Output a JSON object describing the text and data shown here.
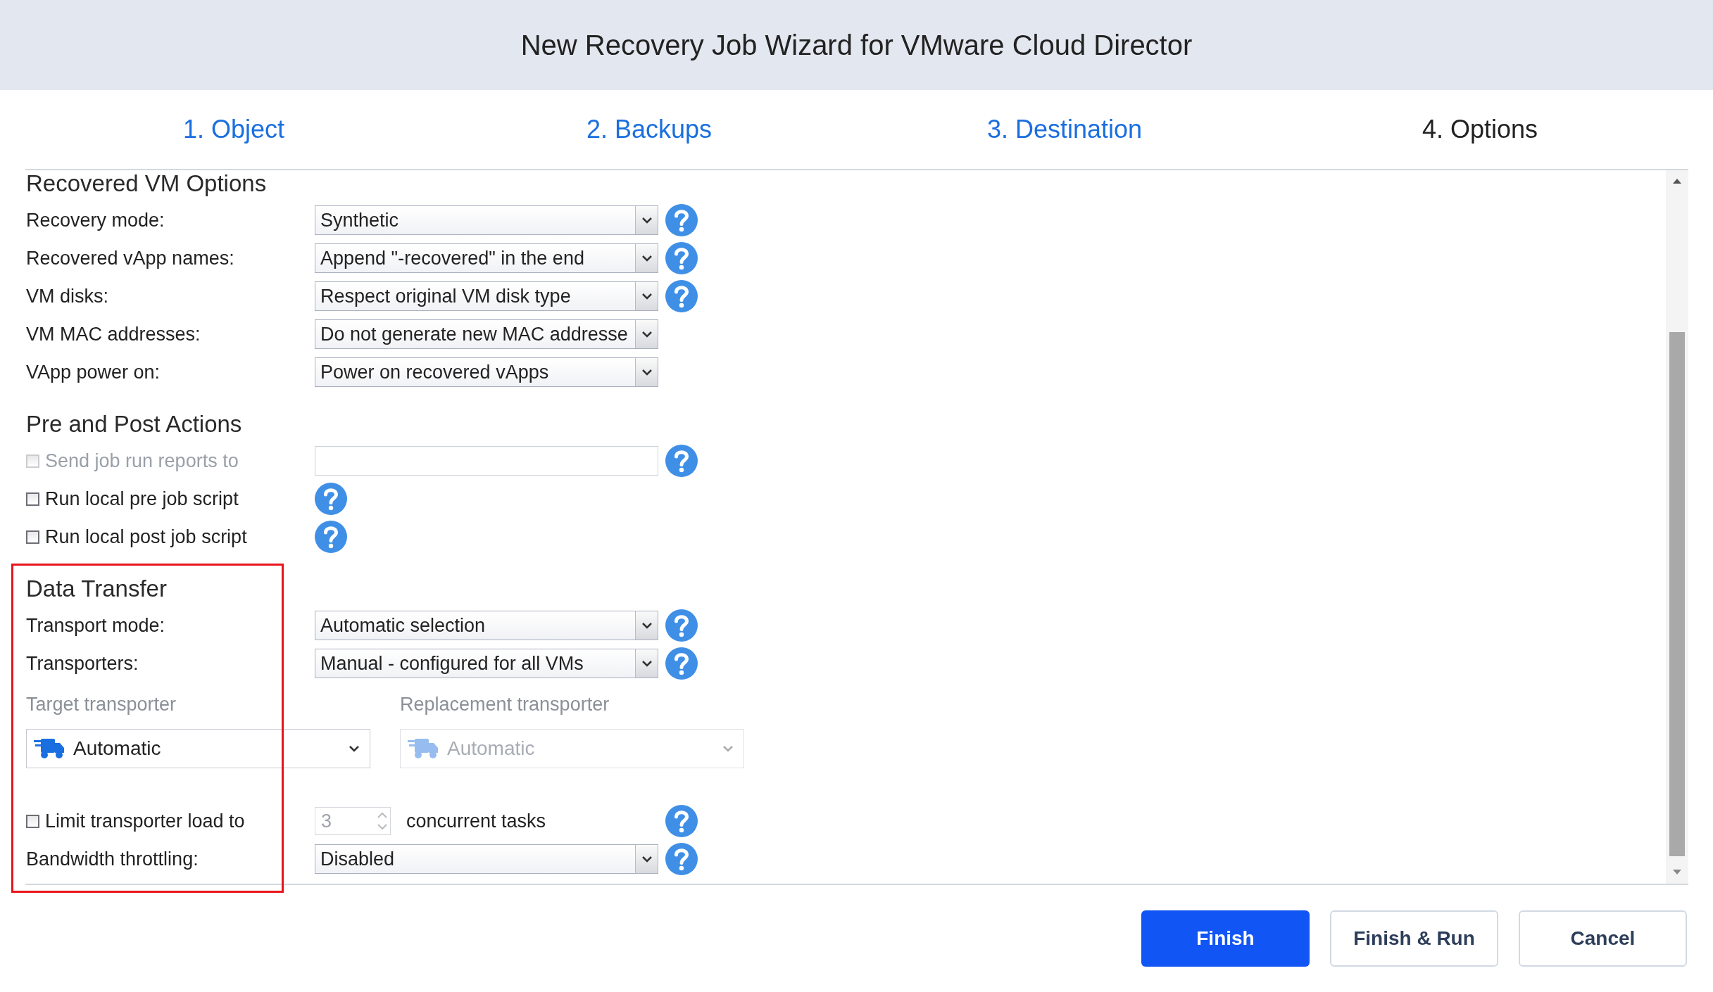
{
  "window": {
    "title": "New Recovery Job Wizard for VMware Cloud Director"
  },
  "steps": [
    {
      "label": "1. Object",
      "selected": false
    },
    {
      "label": "2. Backups",
      "selected": false
    },
    {
      "label": "3. Destination",
      "selected": false
    },
    {
      "label": "4. Options",
      "selected": true
    }
  ],
  "sections": [
    {
      "title": "Recovered VM Options",
      "highlighted": false,
      "rows": [
        {
          "kind": "select",
          "label": "Recovery mode:",
          "value": "Synthetic",
          "help": true
        },
        {
          "kind": "select",
          "label": "Recovered vApp names:",
          "value": "Append \"-recovered\" in the end",
          "help": true
        },
        {
          "kind": "select",
          "label": "VM disks:",
          "value": "Respect original VM disk type",
          "help": true
        },
        {
          "kind": "select",
          "label": "VM MAC addresses:",
          "value": "Do not generate new MAC addresse",
          "help": false
        },
        {
          "kind": "select",
          "label": "VApp power on:",
          "value": "Power on recovered vApps",
          "help": false
        }
      ]
    },
    {
      "title": "Pre and Post Actions",
      "highlighted": false,
      "rows": [
        {
          "kind": "checkbox-field",
          "label": "Send job run reports to",
          "checked": false,
          "disabled": true,
          "help": true
        },
        {
          "kind": "checkbox",
          "label": "Run local pre job script",
          "checked": false,
          "disabled": false,
          "help": true
        },
        {
          "kind": "checkbox",
          "label": "Run local post job script",
          "checked": false,
          "disabled": false,
          "help": true
        }
      ]
    },
    {
      "title": "Data Transfer",
      "highlighted": true,
      "rows": [
        {
          "kind": "select",
          "label": "Transport mode:",
          "value": "Automatic selection",
          "help": true
        },
        {
          "kind": "select",
          "label": "Transporters:",
          "value": "Manual - configured for all VMs",
          "help": true
        },
        {
          "kind": "transporters",
          "columns": [
            {
              "label": "Target transporter",
              "value": "Automatic",
              "disabled": false
            },
            {
              "label": "Replacement transporter",
              "value": "Automatic",
              "disabled": true
            }
          ]
        },
        {
          "kind": "spinner",
          "label": "Limit transporter load to",
          "checked": false,
          "value": "3",
          "suffix": "concurrent tasks",
          "help": true
        },
        {
          "kind": "select",
          "label": "Bandwidth throttling:",
          "value": "Disabled",
          "help": true
        }
      ]
    }
  ],
  "buttons": [
    {
      "label": "Finish",
      "primary": true
    },
    {
      "label": "Finish & Run",
      "primary": false
    },
    {
      "label": "Cancel",
      "primary": false
    }
  ]
}
